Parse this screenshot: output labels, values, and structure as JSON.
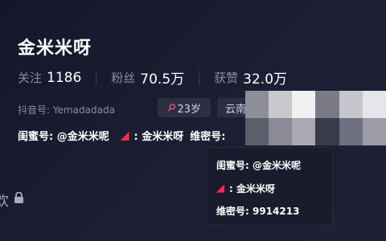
{
  "profile": {
    "name": "金米米呀",
    "stats": [
      {
        "label": "关注",
        "value": "1186"
      },
      {
        "label": "粉丝",
        "value": "70.5万"
      },
      {
        "label": "获赞",
        "value": "32.0万"
      }
    ],
    "douyin_id": "抖音号: Yemadadada",
    "age_tag": "23岁",
    "region_tag": "云南",
    "link_line": {
      "friend": "闺蜜号: @金米米呢",
      "red_app": ": 金米米呀",
      "wechat": "维密号:"
    },
    "tooltip": {
      "friend": "闺蜜号: @金米米呢",
      "red_app": ": 金米米呀",
      "wechat": "维密号: 9914213"
    },
    "likes_tab": "欢"
  },
  "colors": {
    "accent_red": "#ff2b4d",
    "female_pink": "#ff5c8a"
  },
  "icons": [
    "female-icon",
    "red-app-icon",
    "lock-icon"
  ]
}
